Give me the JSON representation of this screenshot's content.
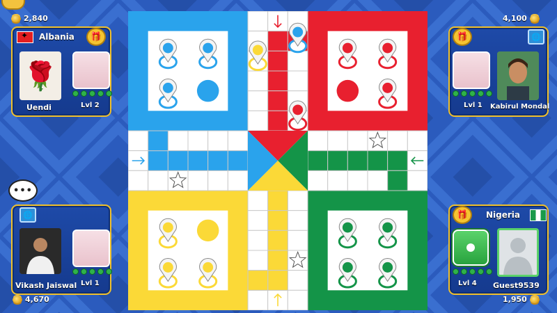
{
  "players": {
    "top_left": {
      "country": "Albania",
      "coins": "2,840",
      "name": "Uendi",
      "level": "Lvl 2"
    },
    "top_right": {
      "coins": "4,100",
      "name": "Kabirul Mondal",
      "level": "Lvl 1"
    },
    "bottom_left": {
      "coins": "4,670",
      "name": "Vikash Jaiswal",
      "level": "Lvl 1"
    },
    "bottom_right": {
      "country": "Nigeria",
      "coins": "1,950",
      "name": "Guest9539",
      "level": "Lvl 4"
    }
  },
  "chat_bubble": "•••",
  "colors": {
    "blue": "#2aa3ec",
    "red": "#e8202f",
    "green": "#149448",
    "yellow": "#fbd937",
    "panel": "#1e4aa8",
    "gold": "#f0c02a"
  },
  "board": {
    "tokens": [
      {
        "color": "blue",
        "location": "blue home"
      },
      {
        "color": "blue",
        "location": "blue home"
      },
      {
        "color": "blue",
        "location": "blue home"
      },
      {
        "color": "blue",
        "location": "top column track"
      },
      {
        "color": "red",
        "location": "red home"
      },
      {
        "color": "red",
        "location": "red home"
      },
      {
        "color": "red",
        "location": "red home"
      },
      {
        "color": "red",
        "location": "red home stretch"
      },
      {
        "color": "yellow",
        "location": "yellow home"
      },
      {
        "color": "yellow",
        "location": "yellow home"
      },
      {
        "color": "yellow",
        "location": "yellow home"
      },
      {
        "color": "yellow",
        "location": "top column track"
      },
      {
        "color": "green",
        "location": "green home"
      },
      {
        "color": "green",
        "location": "green home"
      },
      {
        "color": "green",
        "location": "green home"
      },
      {
        "color": "green",
        "location": "green home"
      }
    ],
    "icons": {
      "arrow": "arrow-icon",
      "star": "safe-star-icon",
      "token": "token-pin-icon"
    }
  }
}
